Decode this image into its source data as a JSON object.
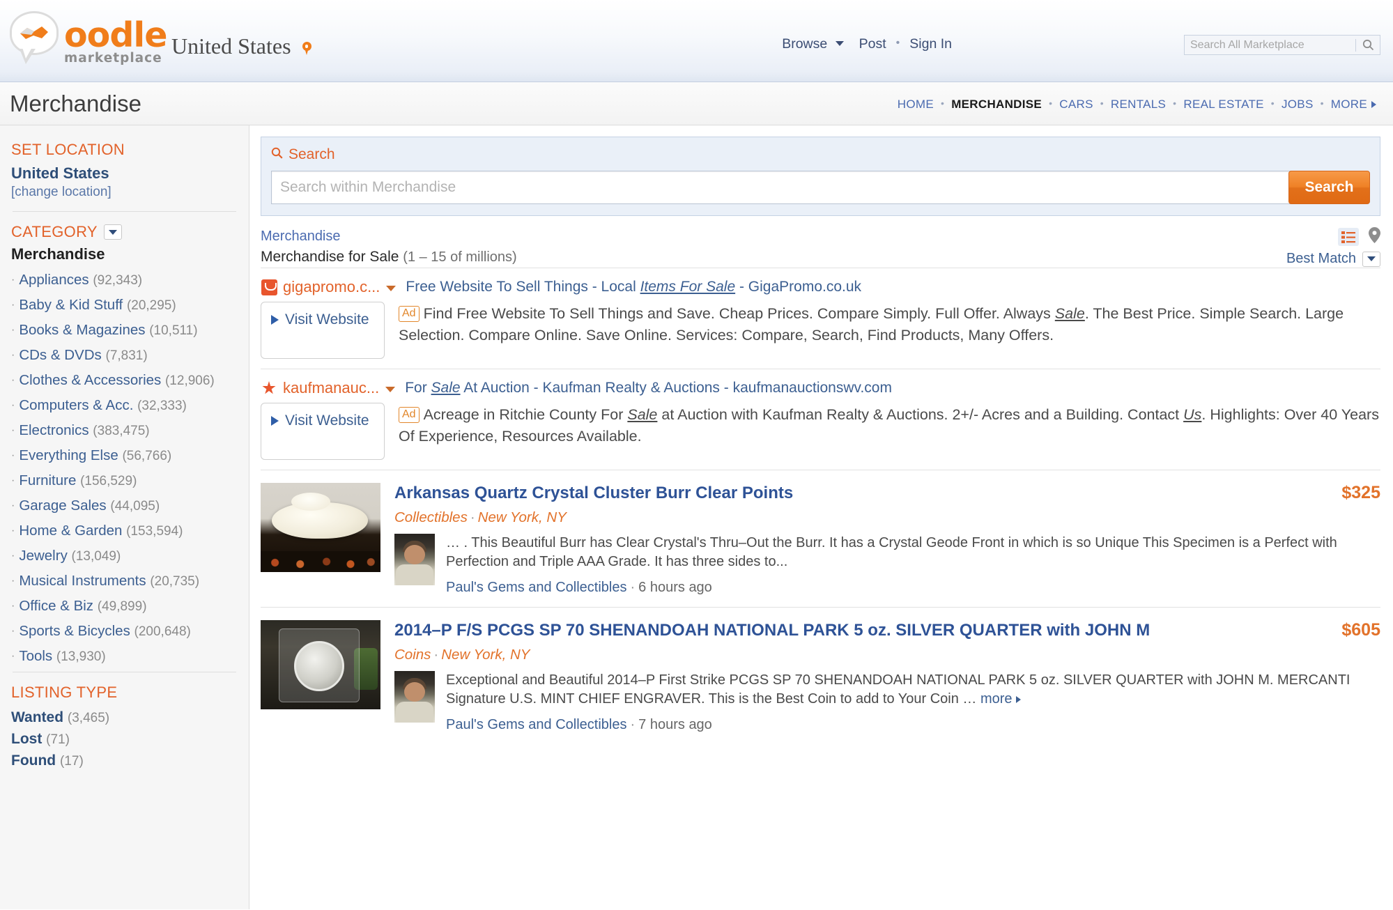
{
  "header": {
    "logo_name": "oodle",
    "logo_sub": "marketplace",
    "country": "United States",
    "nav": [
      {
        "label": "Browse",
        "has_caret": true
      },
      {
        "label": "Post",
        "has_caret": false
      },
      {
        "label": "Sign In",
        "has_caret": false
      }
    ],
    "search_placeholder": "Search All Marketplace",
    "search_value": ""
  },
  "section": {
    "title": "Merchandise",
    "nav": [
      {
        "label": "HOME",
        "active": false
      },
      {
        "label": "MERCHANDISE",
        "active": true
      },
      {
        "label": "CARS",
        "active": false
      },
      {
        "label": "RENTALS",
        "active": false
      },
      {
        "label": "REAL ESTATE",
        "active": false
      },
      {
        "label": "JOBS",
        "active": false
      },
      {
        "label": "MORE",
        "active": false
      }
    ]
  },
  "sidebar": {
    "location_heading": "SET LOCATION",
    "location_value": "United States",
    "change_location": "[change location]",
    "category_heading": "CATEGORY",
    "category_current": "Merchandise",
    "categories": [
      {
        "label": "Appliances",
        "count": "(92,343)"
      },
      {
        "label": "Baby & Kid Stuff",
        "count": "(20,295)"
      },
      {
        "label": "Books & Magazines",
        "count": "(10,511)"
      },
      {
        "label": "CDs & DVDs",
        "count": "(7,831)"
      },
      {
        "label": "Clothes & Accessories",
        "count": "(12,906)"
      },
      {
        "label": "Computers & Acc.",
        "count": "(32,333)"
      },
      {
        "label": "Electronics",
        "count": "(383,475)"
      },
      {
        "label": "Everything Else",
        "count": "(56,766)"
      },
      {
        "label": "Furniture",
        "count": "(156,529)"
      },
      {
        "label": "Garage Sales",
        "count": "(44,095)"
      },
      {
        "label": "Home & Garden",
        "count": "(153,594)"
      },
      {
        "label": "Jewelry",
        "count": "(13,049)"
      },
      {
        "label": "Musical Instruments",
        "count": "(20,735)"
      },
      {
        "label": "Office & Biz",
        "count": "(49,899)"
      },
      {
        "label": "Sports & Bicycles",
        "count": "(200,648)"
      },
      {
        "label": "Tools",
        "count": "(13,930)"
      }
    ],
    "listing_type_heading": "LISTING TYPE",
    "listing_types": [
      {
        "label": "Wanted",
        "count": "(3,465)"
      },
      {
        "label": "Lost",
        "count": "(71)"
      },
      {
        "label": "Found",
        "count": "(17)"
      }
    ]
  },
  "search_panel": {
    "label": "Search",
    "placeholder": "Search within Merchandise",
    "value": "",
    "button_label": "Search"
  },
  "results": {
    "breadcrumb": "Merchandise",
    "heading": "Merchandise for Sale",
    "count": "(1 – 15 of millions)",
    "sort_label": "Best Match"
  },
  "ads": [
    {
      "domain": "gigapromo.c...",
      "icon": "square-favicon-icon",
      "title_pre": "Free Website To Sell Things - Local ",
      "title_em": "Items For Sale",
      "title_post": " - GigaPromo.co.uk",
      "visit_label": "Visit Website",
      "ad_tag": "Ad",
      "desc_1": "Find Free Website To Sell Things and Save. Cheap Prices. Compare Simply. Full Offer. Always ",
      "desc_em": "Sale",
      "desc_2": ". The Best Price. Simple Search. Large Selection. Compare Online. Save Online. Services: Compare, Search, Find Products, Many Offers."
    },
    {
      "domain": "kaufmanauc...",
      "icon": "star-favicon-icon",
      "title_pre": "For ",
      "title_em": "Sale",
      "title_post": " At Auction - Kaufman Realty & Auctions - kaufmanauctionswv.com",
      "visit_label": "Visit Website",
      "ad_tag": "Ad",
      "desc_1": "Acreage in Ritchie County For ",
      "desc_em": "Sale",
      "desc_2": " at Auction with Kaufman Realty & Auctions. 2+/- Acres and a Building. Contact ",
      "desc_em2": "Us",
      "desc_3": ". Highlights: Over 40 Years Of Experience, Resources Available."
    }
  ],
  "listings": [
    {
      "title": "Arkansas Quartz Crystal Cluster Burr Clear Points",
      "price": "$325",
      "category": "Collectibles",
      "location": "New York, NY",
      "description": "… . This Beautiful Burr has Clear Crystal's Thru–Out the Burr. It has a Crystal Geode Front in which is so Unique This Specimen is a Perfect with Perfection and Triple AAA Grade. It has three sides to...",
      "seller": "Paul's Gems and Collectibles",
      "age": "6 hours ago",
      "more_label": ""
    },
    {
      "title": "2014–P F/S PCGS SP 70 SHENANDOAH NATIONAL PARK 5 oz. SILVER QUARTER with JOHN M",
      "price": "$605",
      "category": "Coins",
      "location": "New York, NY",
      "description": "Exceptional and Beautiful 2014–P First Strike PCGS SP 70 SHENANDOAH NATIONAL PARK 5 oz. SILVER QUARTER with JOHN M. MERCANTI Signature U.S. MINT CHIEF ENGRAVER. This is the Best Coin to add to Your Coin … ",
      "seller": "Paul's Gems and Collectibles",
      "age": "7 hours ago",
      "more_label": "more"
    }
  ],
  "colors": {
    "brand_orange": "#f07d1a",
    "link_blue": "#3c5f91",
    "heading_orange": "#e2622a",
    "price_orange": "#e2722a"
  }
}
